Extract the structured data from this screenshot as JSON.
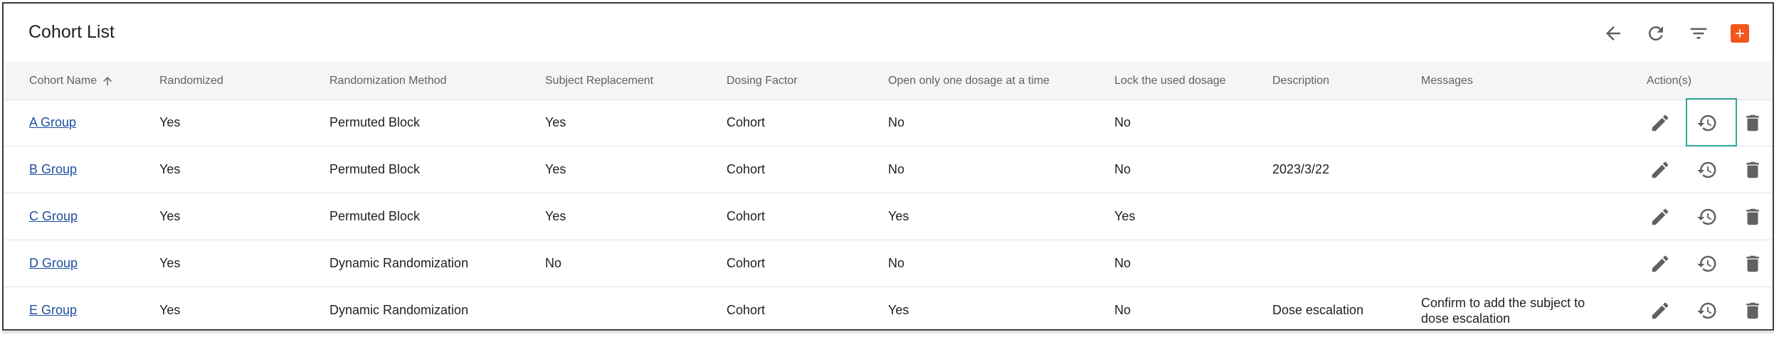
{
  "title": "Cohort List",
  "toolbar": {
    "back_icon": "arrow-left-icon",
    "refresh_icon": "refresh-icon",
    "filter_icon": "filter-list-icon",
    "add_icon": "plus-icon",
    "add_color": "#f2561d"
  },
  "columns": [
    "Cohort Name",
    "Randomized",
    "Randomization Method",
    "Subject Replacement",
    "Dosing Factor",
    "Open only one dosage at a time",
    "Lock the used dosage",
    "Description",
    "Messages",
    "Action(s)"
  ],
  "rows": [
    {
      "name": "A Group",
      "randomized": "Yes",
      "method": "Permuted Block",
      "replacement": "Yes",
      "dosing": "Cohort",
      "open_one": "No",
      "lock": "No",
      "description": "",
      "messages": ""
    },
    {
      "name": "B Group",
      "randomized": "Yes",
      "method": "Permuted Block",
      "replacement": "Yes",
      "dosing": "Cohort",
      "open_one": "No",
      "lock": "No",
      "description": "2023/3/22",
      "messages": ""
    },
    {
      "name": "C Group",
      "randomized": "Yes",
      "method": "Permuted Block",
      "replacement": "Yes",
      "dosing": "Cohort",
      "open_one": "Yes",
      "lock": "Yes",
      "description": "",
      "messages": ""
    },
    {
      "name": "D Group",
      "randomized": "Yes",
      "method": "Dynamic Randomization",
      "replacement": "No",
      "dosing": "Cohort",
      "open_one": "No",
      "lock": "No",
      "description": "",
      "messages": ""
    },
    {
      "name": "E Group",
      "randomized": "Yes",
      "method": "Dynamic Randomization",
      "replacement": "",
      "dosing": "Cohort",
      "open_one": "Yes",
      "lock": "No",
      "description": "Dose escalation",
      "messages": "Confirm to add the subject to dose escalation"
    }
  ],
  "highlight_color": "#2fa89a"
}
